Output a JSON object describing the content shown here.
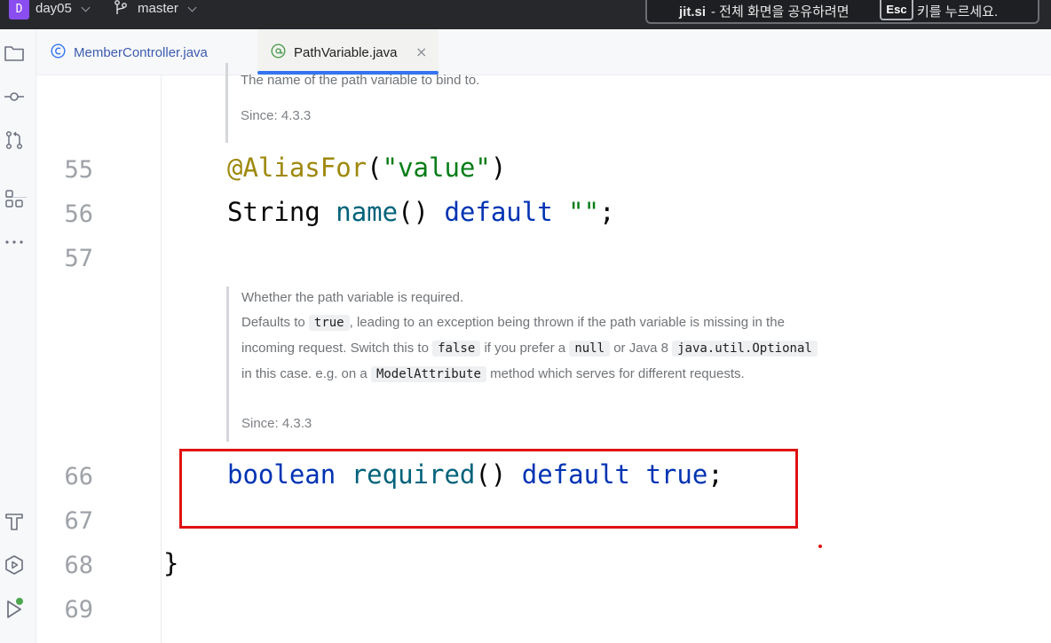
{
  "titlebar": {
    "project_badge": "D",
    "project_name": "day05",
    "branch": "master",
    "jitsi_brand": "jit.si",
    "jitsi_message": "- 전체 화면을 공유하려면",
    "jitsi_key": "Esc",
    "jitsi_message_end": "키를 누르세요."
  },
  "toolstrip": {
    "icons": [
      "project-folder-icon",
      "commit-icon",
      "pull-requests-icon",
      "structure-icon",
      "more-icon",
      "build-icon",
      "services-icon",
      "run-icon"
    ]
  },
  "tabs": [
    {
      "label": "MemberController.java",
      "icon": "class-icon",
      "active": false
    },
    {
      "label": "PathVariable.java",
      "icon": "annotation-icon",
      "active": true,
      "close": "×"
    }
  ],
  "doc1": {
    "text": "The name of the path variable to bind to.",
    "since": "Since: 4.3.3"
  },
  "lines": {
    "55": {
      "num": "55",
      "annotation": "@AliasFor",
      "open": "(",
      "string": "\"value\"",
      "close": ")"
    },
    "56": {
      "num": "56",
      "type": "String",
      "method": "name",
      "parens": "()",
      "keyword": "default",
      "string": "\"\"",
      "semi": ";"
    },
    "57": {
      "num": "57"
    },
    "66": {
      "num": "66",
      "keyword1": "boolean",
      "method": "required",
      "parens": "()",
      "keyword2": "default",
      "value": "true",
      "semi": ";"
    },
    "67": {
      "num": "67"
    },
    "68": {
      "num": "68",
      "brace": "}"
    },
    "69": {
      "num": "69"
    }
  },
  "doc2": {
    "line1": "Whether the path variable is required.",
    "p1": "Defaults to",
    "c1": "true",
    "p2": ", leading to an exception being thrown if the path variable is missing in the",
    "p3": "incoming request. Switch this to",
    "c2": "false",
    "p4": "if you prefer a",
    "c3": "null",
    "p5": "or Java 8",
    "c4": "java.util.Optional",
    "p6": "in this case. e.g. on a",
    "c5": "ModelAttribute",
    "p7": "method which serves for different requests.",
    "since": "Since: 4.3.3"
  },
  "colors": {
    "annotation": "#9e880d",
    "string": "#067d17",
    "keyword": "#0033b3",
    "method": "#00627a",
    "highlight_box": "#e01111",
    "active_tab_underline": "#3574f0"
  }
}
